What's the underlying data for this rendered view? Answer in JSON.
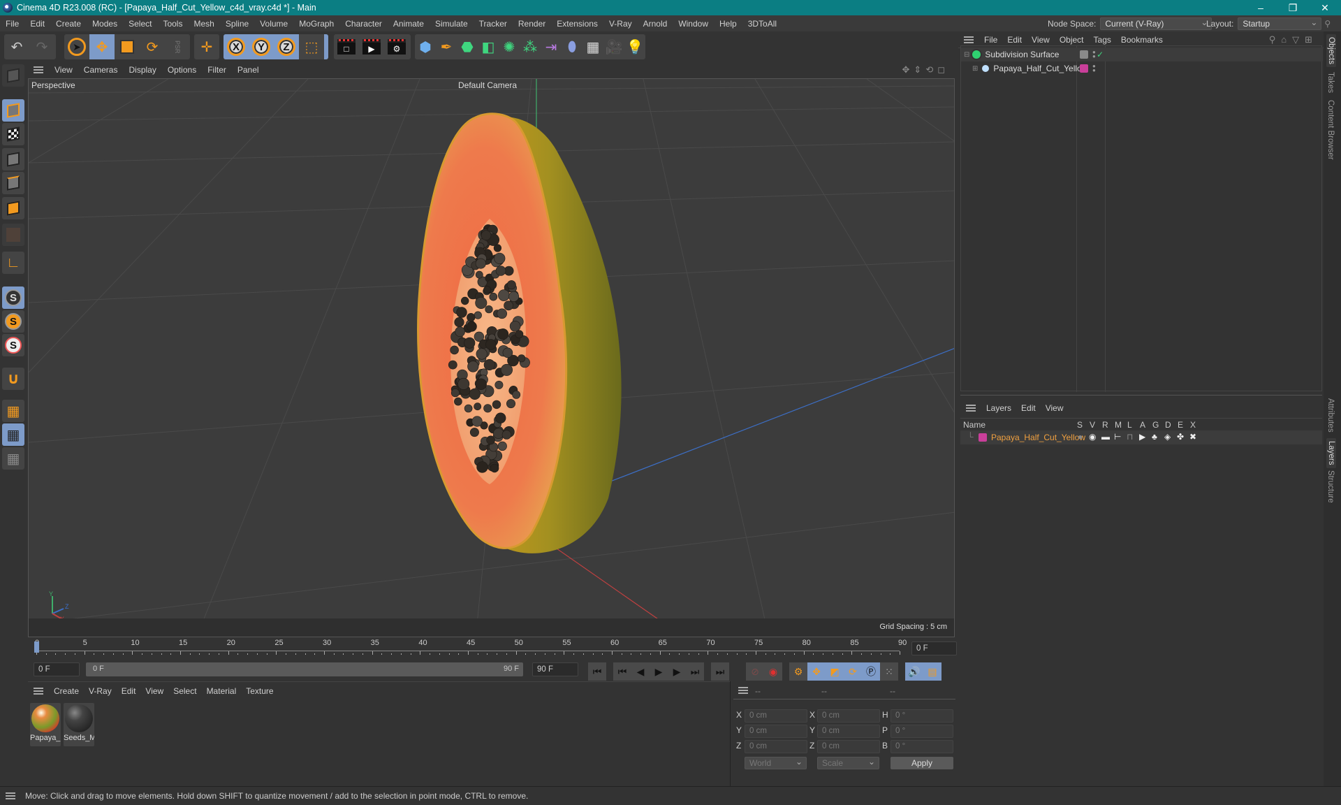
{
  "titlebar": {
    "title": "Cinema 4D R23.008 (RC) - [Papaya_Half_Cut_Yellow_c4d_vray.c4d *] - Main",
    "minimize": "–",
    "restore": "❐",
    "close": "✕"
  },
  "menubar": {
    "items": [
      "File",
      "Edit",
      "Create",
      "Modes",
      "Select",
      "Tools",
      "Mesh",
      "Spline",
      "Volume",
      "MoGraph",
      "Character",
      "Animate",
      "Simulate",
      "Tracker",
      "Render",
      "Extensions",
      "V-Ray",
      "Arnold",
      "Window",
      "Help",
      "3DToAll"
    ],
    "node_space_label": "Node Space:",
    "node_space_value": "Current (V-Ray)",
    "layout_label": "Layout:",
    "layout_value": "Startup"
  },
  "toolbar": {
    "axis_x": "X",
    "axis_y": "Y",
    "axis_z": "Z",
    "psr": "PSR"
  },
  "viewport": {
    "menu": [
      "View",
      "Cameras",
      "Display",
      "Options",
      "Filter",
      "Panel"
    ],
    "view_name": "Perspective",
    "camera": "Default Camera",
    "grid_spacing": "Grid Spacing : 5 cm",
    "axis_labels": {
      "x": "X",
      "y": "Y",
      "z": "Z"
    }
  },
  "timeline": {
    "ticks": [
      "0",
      "5",
      "10",
      "15",
      "20",
      "25",
      "30",
      "35",
      "40",
      "45",
      "50",
      "55",
      "60",
      "65",
      "70",
      "75",
      "80",
      "85",
      "90"
    ],
    "current_frame": "0 F",
    "start_field": "0 F",
    "range_start": "0 F",
    "range_end": "90 F",
    "end_field": "90 F",
    "playhead_frame": 0,
    "max_frame": 90
  },
  "materials": {
    "menu": [
      "Create",
      "V-Ray",
      "Edit",
      "View",
      "Select",
      "Material",
      "Texture"
    ],
    "items": [
      {
        "label": "Papaya_l"
      },
      {
        "label": "Seeds_M"
      }
    ]
  },
  "coordinates": {
    "headers": [
      "--",
      "--",
      "--"
    ],
    "rows": [
      {
        "a": "X",
        "av": "0 cm",
        "b": "X",
        "bv": "0 cm",
        "c": "H",
        "cv": "0 °"
      },
      {
        "a": "Y",
        "av": "0 cm",
        "b": "Y",
        "bv": "0 cm",
        "c": "P",
        "cv": "0 °"
      },
      {
        "a": "Z",
        "av": "0 cm",
        "b": "Z",
        "bv": "0 cm",
        "c": "B",
        "cv": "0 °"
      }
    ],
    "space": "World",
    "mode": "Scale",
    "apply": "Apply"
  },
  "objects": {
    "menu": [
      "File",
      "Edit",
      "View",
      "Object",
      "Tags",
      "Bookmarks"
    ],
    "items": [
      {
        "name": "Subdivision Surface",
        "color": "#8a8a8a"
      },
      {
        "name": "Papaya_Half_Cut_Yellow",
        "color": "#c93f9a"
      }
    ]
  },
  "layers": {
    "menu": [
      "Layers",
      "Edit",
      "View"
    ],
    "columns": [
      "Name",
      "S",
      "V",
      "R",
      "M",
      "L",
      "A",
      "G",
      "D",
      "E",
      "X"
    ],
    "items": [
      {
        "name": "Papaya_Half_Cut_Yellow",
        "color": "#c93f9a",
        "text_color": "#f0a040"
      }
    ]
  },
  "side_tabs": {
    "top": [
      "Objects",
      "Takes",
      "Content Browser"
    ],
    "bottom": [
      "Attributes",
      "Layers",
      "Structure"
    ]
  },
  "statusbar": {
    "text": "Move: Click and drag to move elements. Hold down SHIFT to quantize movement / add to the selection in point mode, CTRL to remove."
  },
  "colors": {
    "accent_teal": "#0b7e83",
    "active_blue": "#7d9bc9",
    "tool_orange": "#f29a1f"
  }
}
